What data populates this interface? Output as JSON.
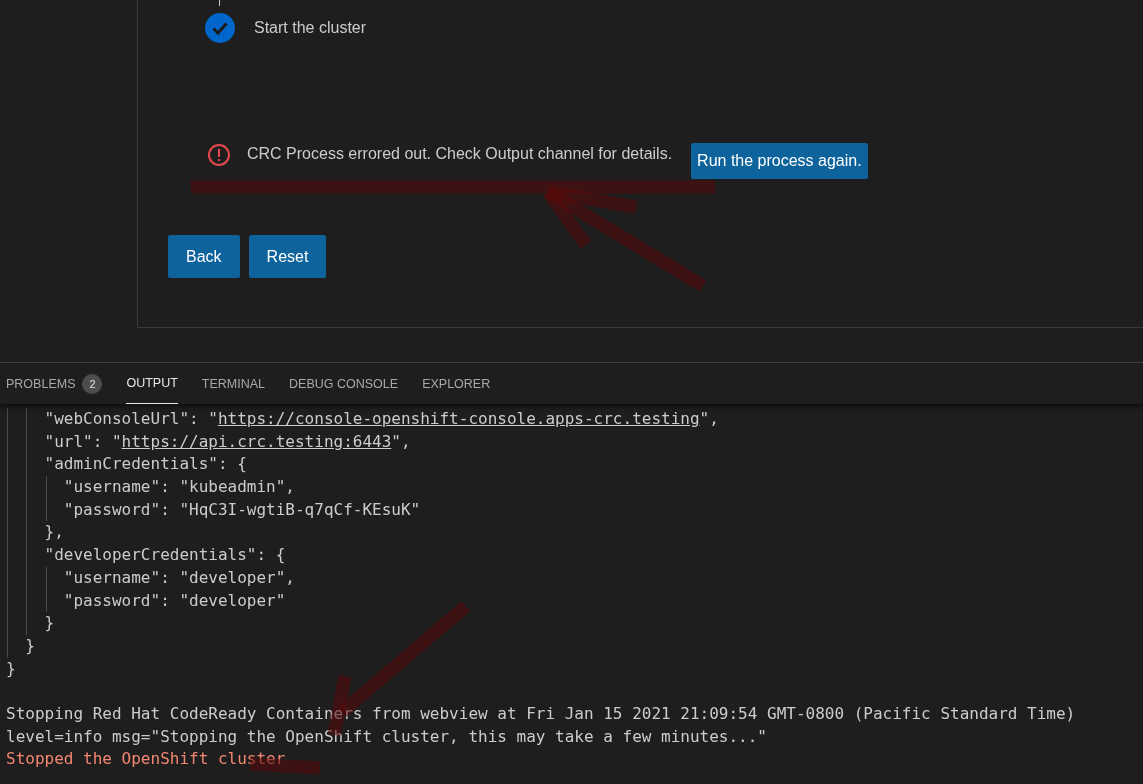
{
  "steps": [
    {
      "label": "Start the cluster",
      "done": true
    }
  ],
  "error": {
    "message": "CRC Process errored out. Check Output channel for details.",
    "action": "Run the process again."
  },
  "buttons": [
    "Back",
    "Reset"
  ],
  "panel_tabs": [
    {
      "label": "PROBLEMS",
      "badge": "2",
      "selected": false
    },
    {
      "label": "OUTPUT",
      "selected": true
    },
    {
      "label": "TERMINAL",
      "selected": false
    },
    {
      "label": "DEBUG CONSOLE",
      "selected": false
    },
    {
      "label": "EXPLORER",
      "selected": false
    }
  ],
  "output": [
    {
      "kind": "plain",
      "segments": [
        {
          "text": "    \"webConsoleUrl\": \"",
          "link": false
        },
        {
          "text": "https://console-openshift-console.apps-crc.testing",
          "link": true
        },
        {
          "text": "\",",
          "link": false
        }
      ]
    },
    {
      "kind": "plain",
      "segments": [
        {
          "text": "    \"url\": \"",
          "link": false
        },
        {
          "text": "https://api.crc.testing:6443",
          "link": true
        },
        {
          "text": "\",",
          "link": false
        }
      ]
    },
    {
      "kind": "plain",
      "segments": [
        {
          "text": "    \"adminCredentials\": {",
          "link": false
        }
      ]
    },
    {
      "kind": "plain",
      "segments": [
        {
          "text": "      \"username\": \"kubeadmin\",",
          "link": false
        }
      ]
    },
    {
      "kind": "plain",
      "segments": [
        {
          "text": "      \"password\": \"HqC3I-wgtiB-q7qCf-KEsuK\"",
          "link": false
        }
      ]
    },
    {
      "kind": "plain",
      "segments": [
        {
          "text": "    },",
          "link": false
        }
      ]
    },
    {
      "kind": "plain",
      "segments": [
        {
          "text": "    \"developerCredentials\": {",
          "link": false
        }
      ]
    },
    {
      "kind": "plain",
      "segments": [
        {
          "text": "      \"username\": \"developer\",",
          "link": false
        }
      ]
    },
    {
      "kind": "plain",
      "segments": [
        {
          "text": "      \"password\": \"developer\"",
          "link": false
        }
      ]
    },
    {
      "kind": "plain",
      "segments": [
        {
          "text": "    }",
          "link": false
        }
      ]
    },
    {
      "kind": "plain",
      "segments": [
        {
          "text": "  }",
          "link": false
        }
      ]
    },
    {
      "kind": "plain",
      "segments": [
        {
          "text": "}",
          "link": false
        }
      ]
    },
    {
      "kind": "blank"
    },
    {
      "kind": "plain",
      "segments": [
        {
          "text": "Stopping Red Hat CodeReady Containers from webview at Fri Jan 15 2021 21:09:54 GMT-0800 (Pacific Standard Time)",
          "link": false
        }
      ]
    },
    {
      "kind": "plain",
      "segments": [
        {
          "text": "level=info msg=\"Stopping the OpenShift cluster, this may take a few minutes...\"",
          "link": false
        }
      ]
    },
    {
      "kind": "error",
      "segments": [
        {
          "text": "Stopped the OpenShift cluster",
          "link": false
        }
      ]
    }
  ]
}
